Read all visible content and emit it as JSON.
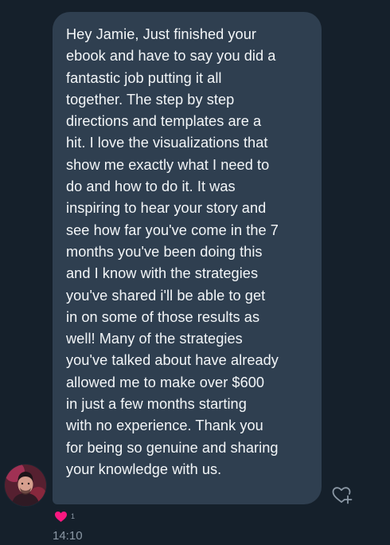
{
  "message": {
    "text": "Hey Jamie,  Just finished your\nebook and have to say you did a\nfantastic job putting it all\ntogether.  The step by step\ndirections and templates are a\nhit.  I love the visualizations that\nshow me exactly what I need to\ndo and how to do it. It was\ninspiring to hear your story and\nsee how far you've come in the 7\nmonths you've been doing this\nand I know with the strategies\nyou've shared i'll be able to get\nin on some of those results as\nwell! Many of the strategies\nyou've talked about have already\nallowed me to make over $600\nin just a few months starting\nwith no experience.   Thank you\nfor being so genuine and sharing\nyour knowledge with us.",
    "timestamp": "14:10"
  },
  "reaction": {
    "icon": "heart-icon",
    "count": "1",
    "color": "#f91880"
  },
  "add_reaction": {
    "icon": "heart-plus-icon"
  },
  "colors": {
    "background": "#15202b",
    "bubble": "#2f3f50",
    "text": "#f3f6f8",
    "muted": "#8b98a5"
  }
}
